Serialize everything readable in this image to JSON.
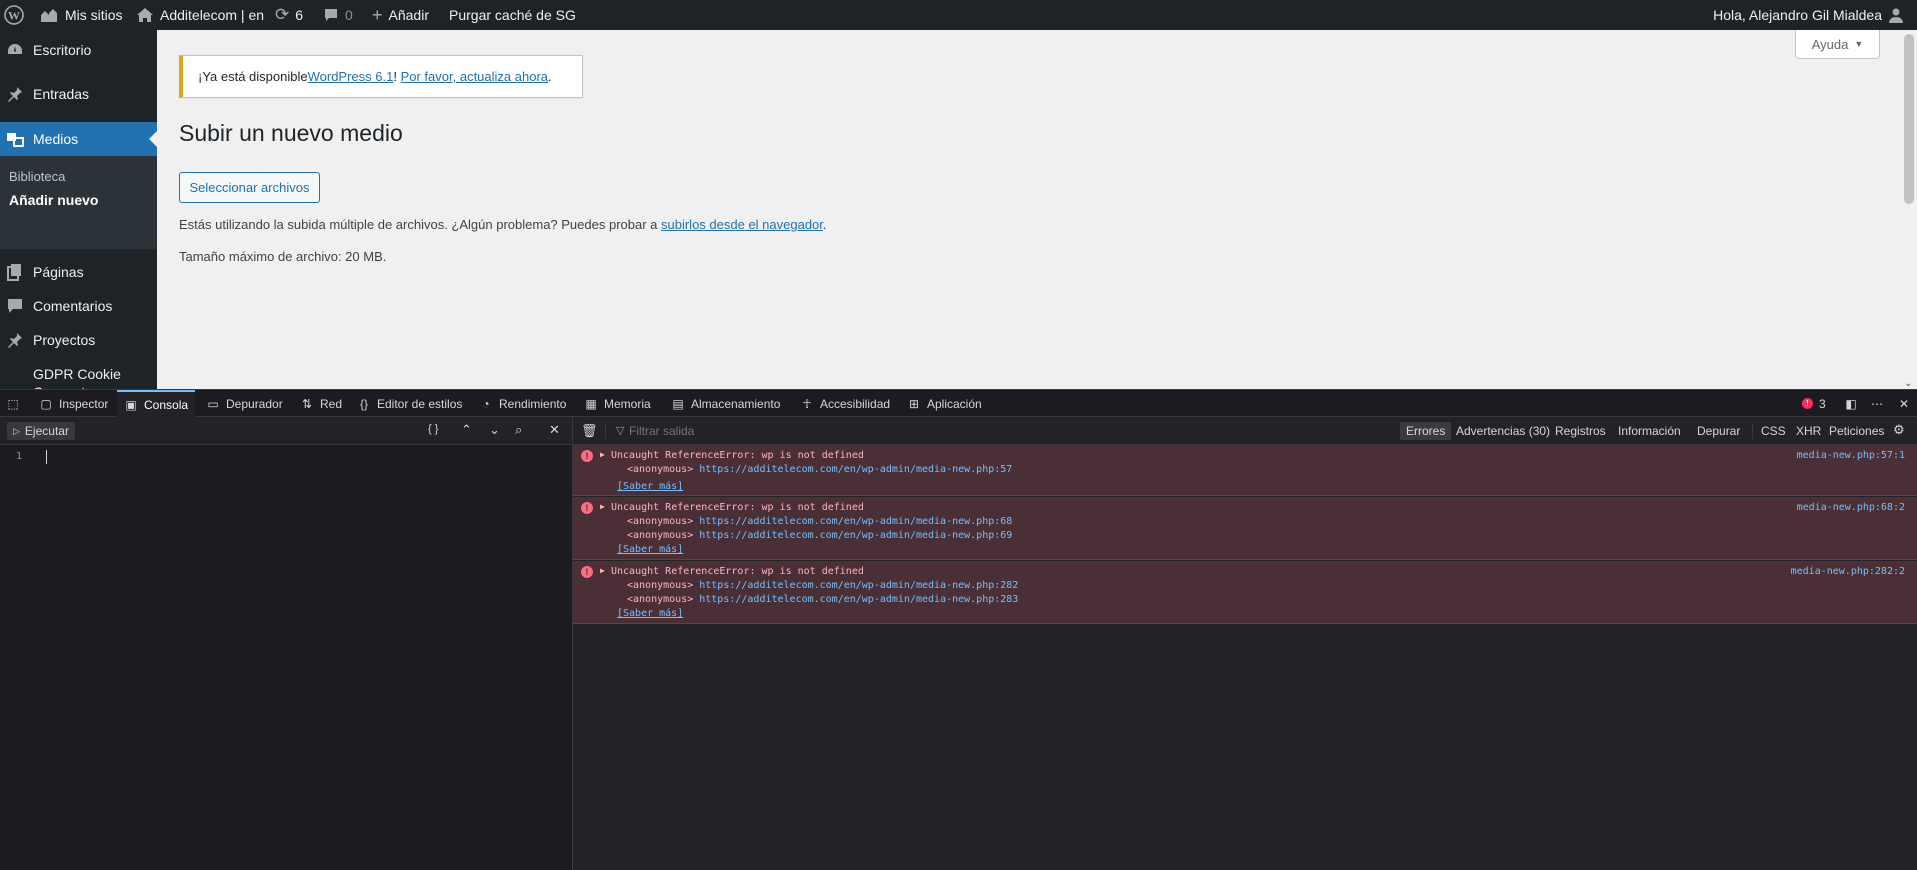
{
  "adminbar": {
    "my_sites": "Mis sitios",
    "site_name": "Additelecom | en",
    "updates_count": "6",
    "comments_count": "0",
    "add_new": "Añadir",
    "purge_cache": "Purgar caché de SG",
    "greeting": "Hola, Alejandro Gil Mialdea"
  },
  "sidebar": {
    "items": [
      {
        "label": "Escritorio",
        "icon": "dashboard-icon"
      },
      {
        "label": "Entradas",
        "icon": "pin-icon"
      },
      {
        "label": "Medios",
        "icon": "media-icon"
      },
      {
        "label": "Páginas",
        "icon": "pages-icon"
      },
      {
        "label": "Comentarios",
        "icon": "comment-icon"
      },
      {
        "label": "Proyectos",
        "icon": "pin-icon"
      },
      {
        "label": "GDPR Cookie Consent",
        "icon": ""
      }
    ],
    "submenu": [
      "Biblioteca",
      "Añadir nuevo"
    ]
  },
  "main": {
    "help_label": "Ayuda",
    "notice_prefix": "¡Ya está disponible ",
    "notice_link1": "WordPress 6.1",
    "notice_mid": "! ",
    "notice_link2": "Por favor, actualiza ahora",
    "notice_suffix": ".",
    "page_title": "Subir un nuevo medio",
    "select_files": "Seleccionar archivos",
    "multi_upload_text": "Estás utilizando la subida múltiple de archivos. ¿Algún problema? Puedes probar a ",
    "browser_upload_link": "subirlos desde el navegador",
    "multi_upload_suffix": ".",
    "max_size": "Tamaño máximo de archivo: 20 MB."
  },
  "devtools": {
    "tabs": [
      "Inspector",
      "Consola",
      "Depurador",
      "Red",
      "Editor de estilos",
      "Rendimiento",
      "Memoria",
      "Almacenamiento",
      "Accesibilidad",
      "Aplicación"
    ],
    "error_count": "3",
    "run_label": "Ejecutar",
    "braces_label": "{ }",
    "line_number": "1",
    "filter_placeholder": "Filtrar salida",
    "filters": [
      "Errores",
      "Advertencias (30)",
      "Registros",
      "Información",
      "Depurar",
      "CSS",
      "XHR",
      "Peticiones"
    ],
    "messages": [
      {
        "text": "Uncaught ReferenceError: wp is not defined",
        "location": "media-new.php:57:1",
        "frames": [
          {
            "name": "<anonymous>",
            "url": "https://additelecom.com/en/wp-admin/media-new.php:57"
          }
        ],
        "learn_more": "[Saber más]"
      },
      {
        "text": "Uncaught ReferenceError: wp is not defined",
        "location": "media-new.php:68:2",
        "frames": [
          {
            "name": "<anonymous>",
            "url": "https://additelecom.com/en/wp-admin/media-new.php:68"
          },
          {
            "name": "<anonymous>",
            "url": "https://additelecom.com/en/wp-admin/media-new.php:69"
          }
        ],
        "learn_more": "[Saber más]"
      },
      {
        "text": "Uncaught ReferenceError: wp is not defined",
        "location": "media-new.php:282:2",
        "frames": [
          {
            "name": "<anonymous>",
            "url": "https://additelecom.com/en/wp-admin/media-new.php:282"
          },
          {
            "name": "<anonymous>",
            "url": "https://additelecom.com/en/wp-admin/media-new.php:283"
          }
        ],
        "learn_more": "[Saber más]"
      }
    ]
  },
  "colors": {
    "adminbar_bg": "#1d2327",
    "accent": "#2271b1",
    "notice_border": "#dba617",
    "error_bg": "#4b2f36",
    "error_text": "#ffb3bf",
    "link_blue": "#75bfff"
  }
}
